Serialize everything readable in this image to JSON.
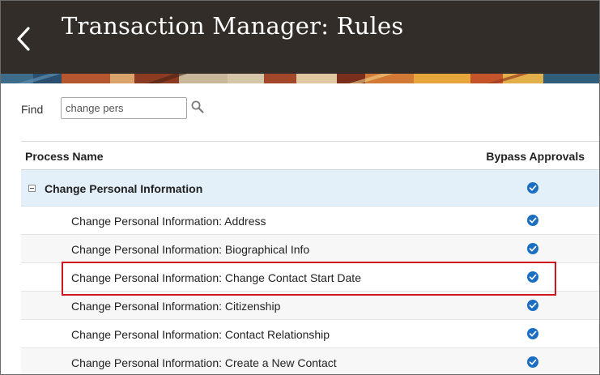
{
  "header": {
    "title": "Transaction Manager: Rules",
    "back_icon": "chevron-left-icon",
    "background_color": "#322d28"
  },
  "search": {
    "label": "Find",
    "value": "change pers",
    "icon": "search-icon"
  },
  "table": {
    "columns": [
      "Process Name",
      "Bypass Approvals"
    ],
    "group": {
      "label": "Change Personal Information",
      "expanded": true,
      "bypass_approvals": true
    },
    "rows": [
      {
        "name": "Change Personal Information: Address",
        "bypass_approvals": true
      },
      {
        "name": "Change Personal Information: Biographical Info",
        "bypass_approvals": true
      },
      {
        "name": "Change Personal Information: Change Contact Start Date",
        "bypass_approvals": true,
        "highlighted": true
      },
      {
        "name": "Change Personal Information: Citizenship",
        "bypass_approvals": true
      },
      {
        "name": "Change Personal Information: Contact Relationship",
        "bypass_approvals": true
      },
      {
        "name": "Change Personal Information: Create a New Contact",
        "bypass_approvals": true
      }
    ]
  },
  "colors": {
    "check_blue": "#1b6ec2",
    "group_row": "#e3eff9",
    "highlight_border": "#d0161c"
  }
}
